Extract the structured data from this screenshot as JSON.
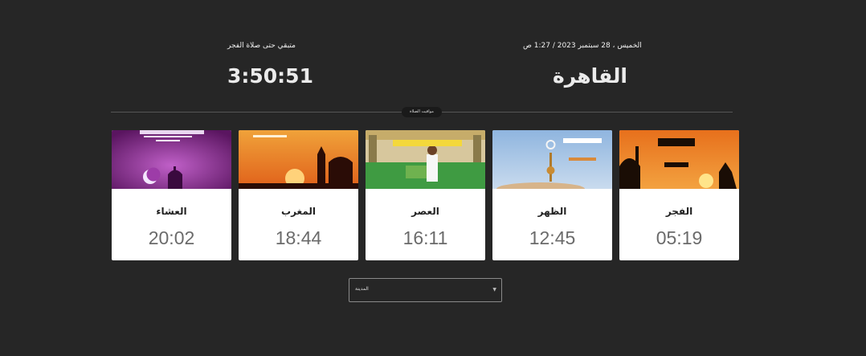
{
  "header": {
    "date_time": "الخميس ، 28 سبتمبر 2023 / 1:27 ص",
    "remaining_label": "متبقي حتى صلاة الفجر",
    "city": "القاهرة",
    "countdown": "3:50:51"
  },
  "divider_label": "مواقيت الصلاة",
  "prayers": [
    {
      "name": "العشاء",
      "time": "20:02",
      "image_text": "صلاة العشاء"
    },
    {
      "name": "المغرب",
      "time": "18:44",
      "image_text": "أذان المغرب"
    },
    {
      "name": "العصر",
      "time": "16:11",
      "image_text": "صلاة العصر"
    },
    {
      "name": "الظهر",
      "time": "12:45",
      "image_text": "صلاة الظهر"
    },
    {
      "name": "الفجر",
      "time": "05:19",
      "image_text": "صلاة الفجر"
    }
  ],
  "city_select": {
    "label": "المدينة"
  }
}
